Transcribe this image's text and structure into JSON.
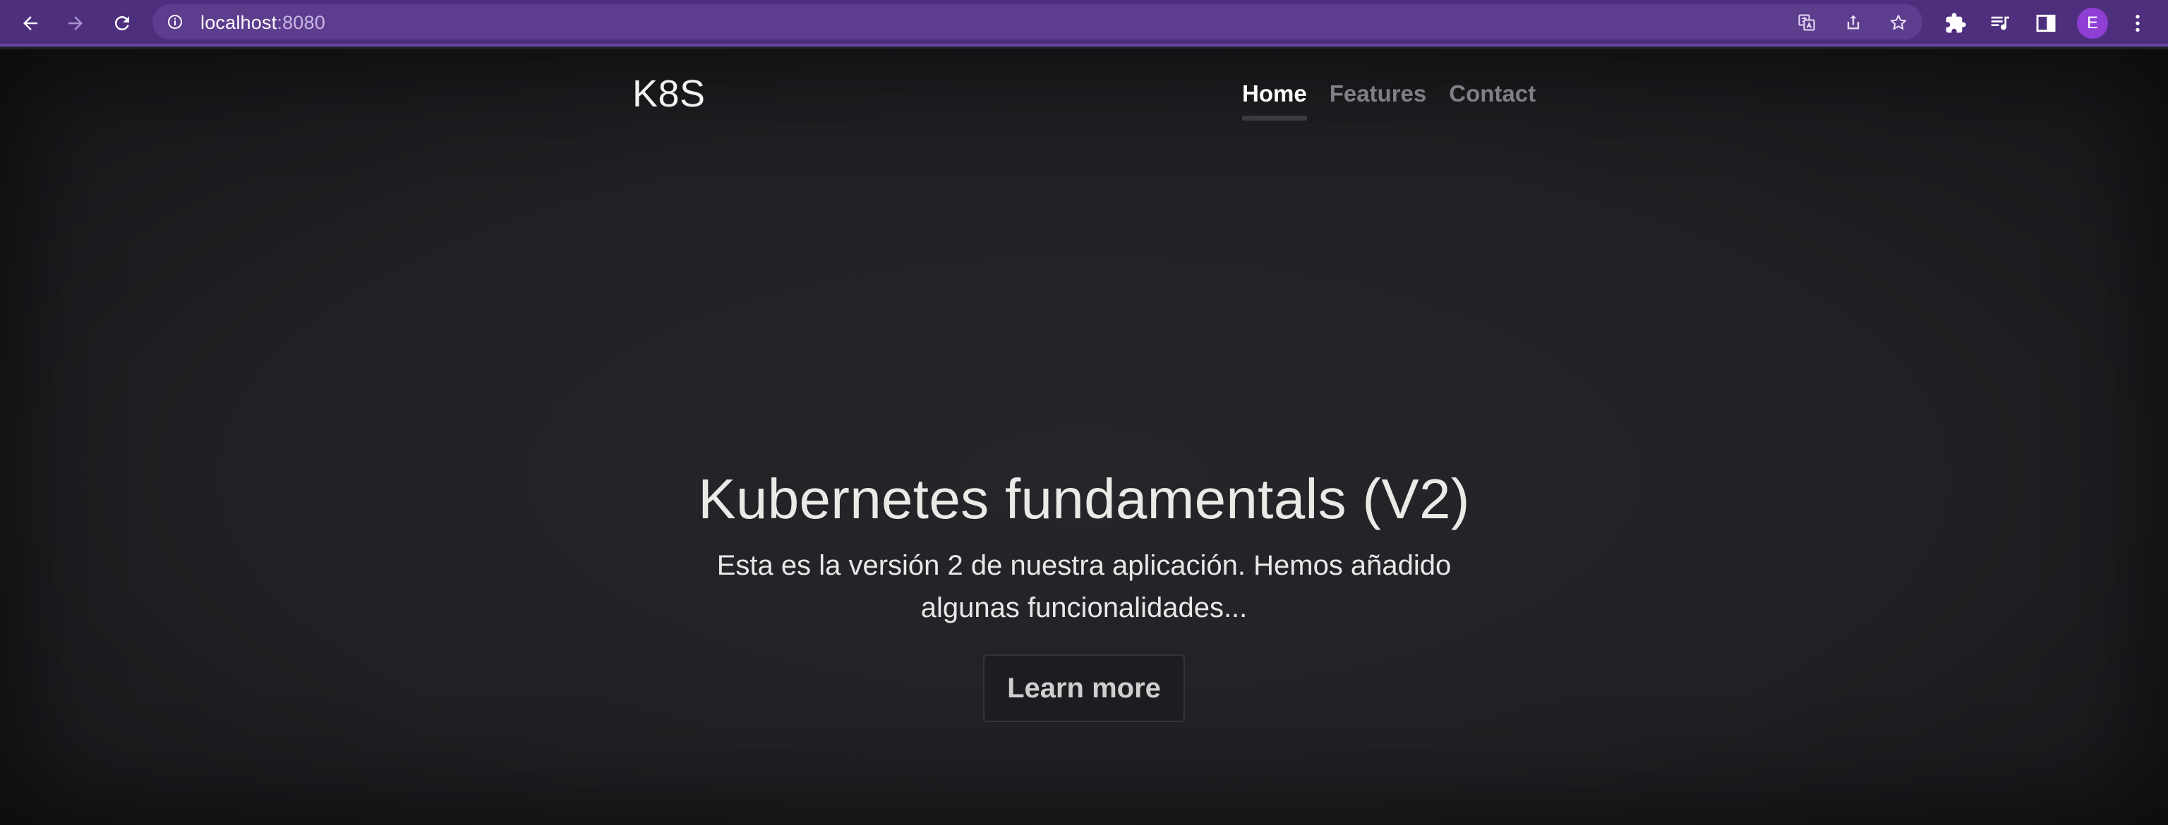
{
  "browser": {
    "url_host": "localhost",
    "url_port": ":8080",
    "profile_initial": "E",
    "toolbar_icons": [
      "back-icon",
      "forward-icon",
      "reload-icon",
      "info-icon",
      "translate-icon",
      "share-icon",
      "bookmark-star-icon",
      "extensions-icon",
      "media-queue-icon",
      "side-panel-icon",
      "kebab-menu-icon"
    ]
  },
  "site": {
    "brand": "K8S",
    "nav": [
      {
        "label": "Home",
        "active": true
      },
      {
        "label": "Features",
        "active": false
      },
      {
        "label": "Contact",
        "active": false
      }
    ]
  },
  "hero": {
    "title": "Kubernetes fundamentals (V2)",
    "description": "Esta es la versión 2 de nuestra aplicación. Hemos añadido algunas funcionalidades...",
    "button_label": "Learn more"
  },
  "colors": {
    "chrome": "#4e2f7e",
    "omnibox": "#5d3d8e",
    "page_background": "#202124",
    "avatar": "#8f3fd4"
  }
}
